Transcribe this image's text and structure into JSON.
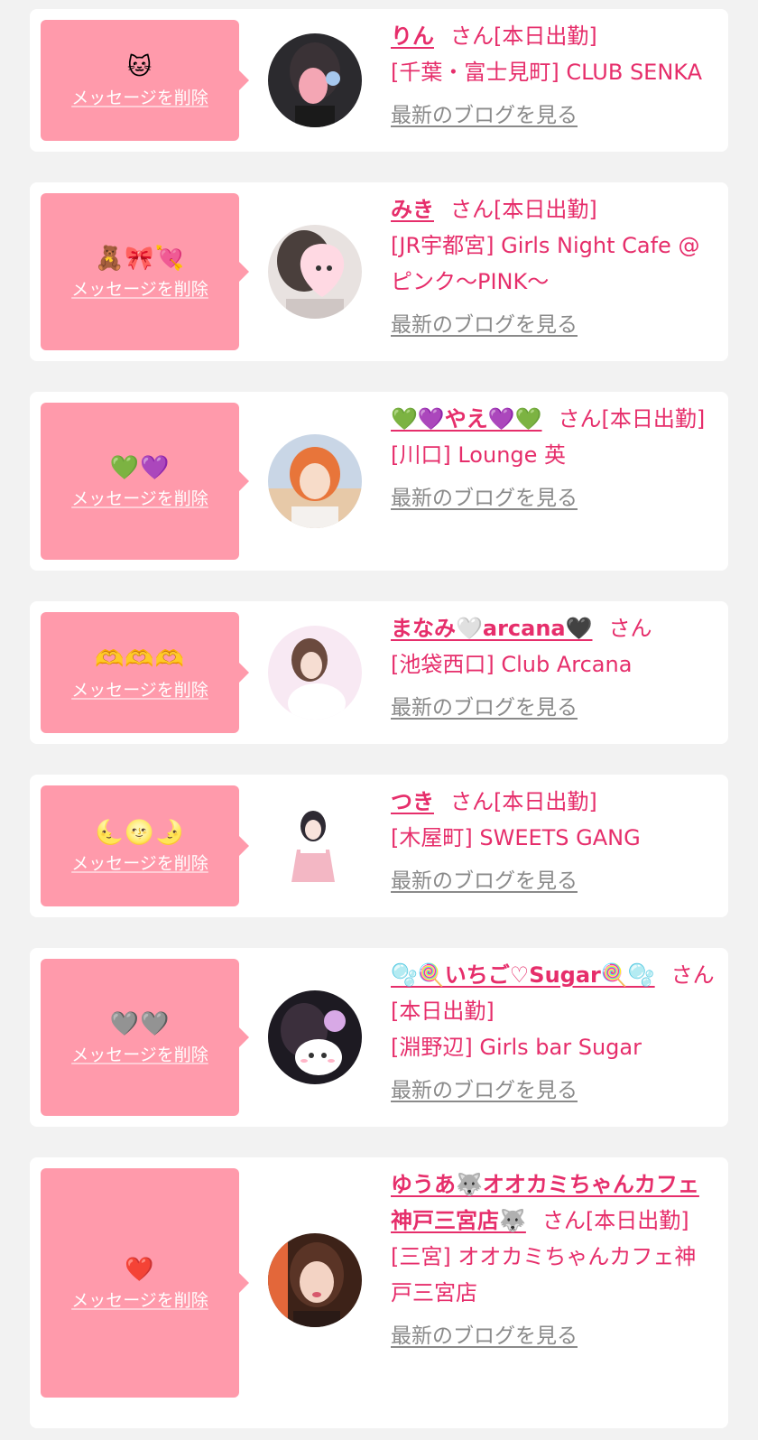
{
  "common": {
    "delete_label": "メッセージを削除",
    "blog_label": "最新のブログを見る"
  },
  "colors": {
    "bubble": "#ff9aab",
    "accent": "#e62e6b",
    "link_gray": "#8a8a8a",
    "background": "#f2f2f2"
  },
  "messages": [
    {
      "emoji": "🐱",
      "name": "りん",
      "suffix": "さん[本日出勤]",
      "shop": "[千葉・富士見町] CLUB SENKA",
      "avatar_icon": "avatar-photo-icon"
    },
    {
      "emoji": "🧸🎀💘",
      "name": "みき",
      "suffix": "さん[本日出勤]",
      "shop": "[JR宇都宮] Girls Night Cafe @ピンク〜PINK〜",
      "avatar_icon": "avatar-photo-icon"
    },
    {
      "emoji": "💚💜",
      "name": "💚💜やえ💜💚",
      "suffix": "さん[本日出勤]",
      "shop": "[川口] Lounge 英",
      "avatar_icon": "avatar-photo-icon"
    },
    {
      "emoji": "🫶🫶🫶",
      "name": "まなみ🤍arcana🖤",
      "suffix": "さん",
      "shop": "[池袋西口] Club Arcana",
      "avatar_icon": "avatar-photo-icon"
    },
    {
      "emoji": "🌜🌝🌛",
      "name": "つき",
      "suffix": "さん[本日出勤]",
      "shop": "[木屋町] SWEETS GANG",
      "avatar_icon": "avatar-photo-icon"
    },
    {
      "emoji": "🩶🩶",
      "name": "🫧🍭いちご♡Sugar🍭🫧",
      "suffix": "さん[本日出勤]",
      "shop": "[淵野辺] Girls bar Sugar",
      "avatar_icon": "avatar-photo-icon"
    },
    {
      "emoji": "❤️",
      "name": "ゆうあ🐺オオカミちゃんカフェ神戸三宮店🐺",
      "suffix": "さん[本日出勤]",
      "shop": "[三宮] オオカミちゃんカフェ神戸三宮店",
      "avatar_icon": "avatar-photo-icon"
    }
  ]
}
